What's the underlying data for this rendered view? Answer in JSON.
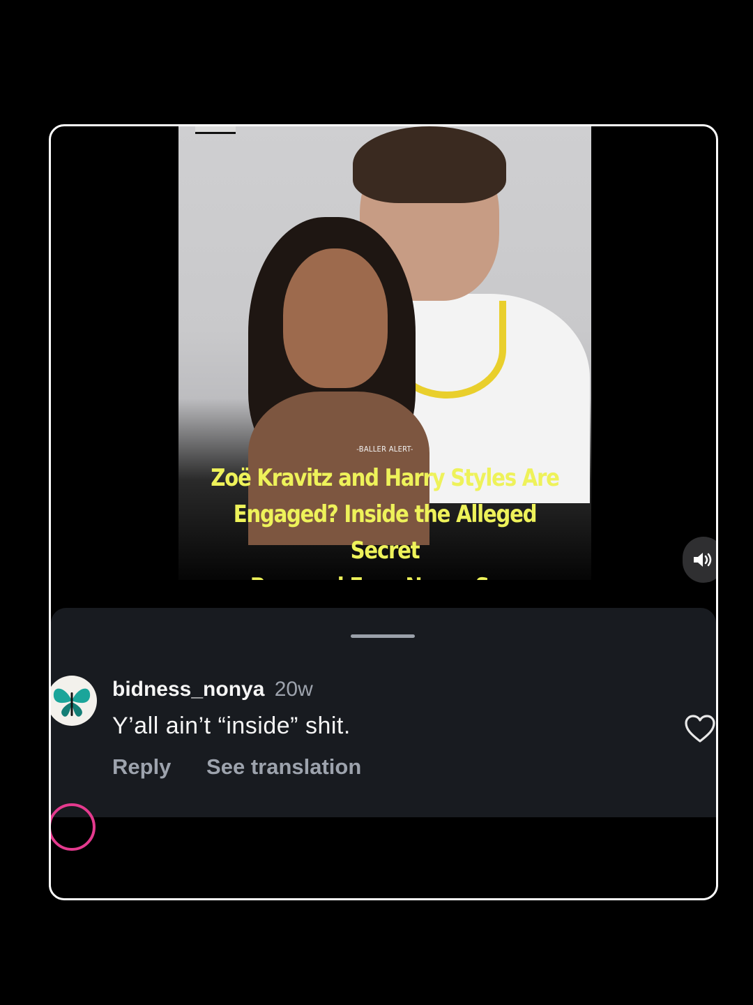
{
  "post": {
    "brand_label": "-BALLER ALERT-",
    "headline_lines": [
      "Zoë Kravitz and Harry Styles Are",
      "Engaged? Inside the Alleged Secret",
      "Proposal Fans Never Saw Coming"
    ]
  },
  "comment": {
    "username": "bidness_nonya",
    "time": "20w",
    "text": "Y’all ain’t “inside” shit.",
    "reply_label": "Reply",
    "translate_label": "See translation"
  },
  "icons": {
    "sound": "speaker-icon",
    "like": "heart-icon",
    "avatar": "butterfly-avatar"
  },
  "colors": {
    "headline": "#eef25a",
    "sheet_bg": "#181b20",
    "secondary_text": "#9da3ad"
  }
}
